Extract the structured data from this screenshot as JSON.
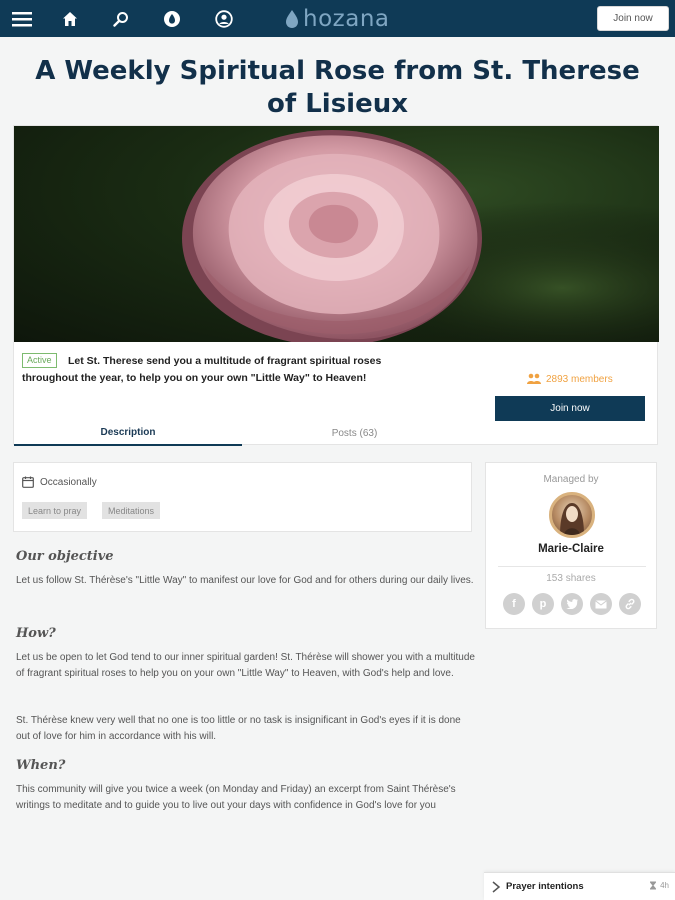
{
  "header": {
    "logo_text": "hozana",
    "join_label": "Join now",
    "icons": [
      "menu-icon",
      "home-icon",
      "search-icon",
      "community-icon",
      "account-icon"
    ]
  },
  "page": {
    "title": "A Weekly Spiritual Rose from St. Therese of Lisieux"
  },
  "community": {
    "status_badge": "Active",
    "summary": "Let St. Therese send you a multitude of fragrant spiritual roses throughout the year, to help you on your own \"Little Way\" to Heaven!",
    "members_text": "2893 members",
    "join_label": "Join now",
    "tabs": [
      {
        "label": "Description",
        "active": true
      },
      {
        "label": "Posts (63)",
        "active": false
      }
    ]
  },
  "info": {
    "frequency": "Occasionally",
    "tags": [
      "Learn to pray",
      "Meditations"
    ]
  },
  "content": {
    "objective_heading": "Our objective",
    "objective_text": "Let us follow St. Thérèse's \"Little Way\" to manifest our love for God and for others during our daily lives.",
    "how_heading": "How?",
    "how_text_1": "Let us be open to let God tend to our inner spiritual garden! St. Thérèse will shower you with a multitude of fragrant spiritual roses to help you on your own \"Little Way\" to Heaven, with God's help and love.",
    "how_text_2": "St. Thérèse knew very well that no one is too little or no task is insignificant in God's eyes if it is done out of love for him in accordance with his will.",
    "when_heading": "When?",
    "when_text": "This community will give you twice a week (on Monday and Friday) an excerpt from Saint Thérèse's writings to meditate and to guide you to live out your days with confidence in God's love for you"
  },
  "sidebar": {
    "managed_by": "Managed by",
    "manager_name": "Marie-Claire",
    "shares": "153 shares",
    "share_icons": [
      "facebook-icon",
      "pinterest-icon",
      "twitter-icon",
      "email-icon",
      "link-icon"
    ]
  },
  "prayer_bar": {
    "label": "Prayer intentions",
    "time": "4h"
  },
  "colors": {
    "navy": "#0f3a56",
    "title": "#12304a",
    "active_green": "#6aa95c",
    "members_orange": "#f0a242"
  }
}
